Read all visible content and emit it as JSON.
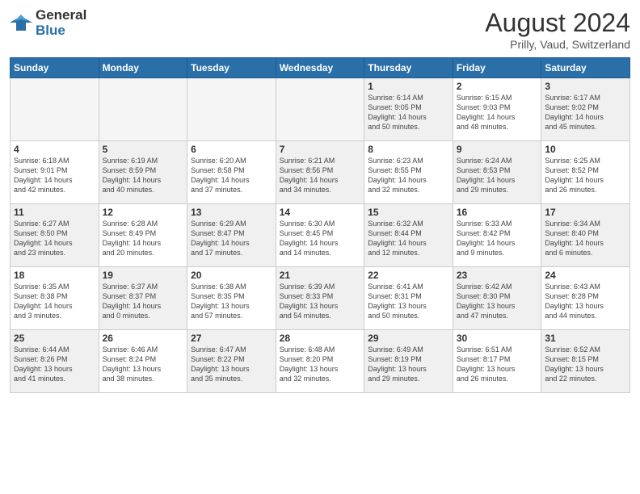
{
  "logo": {
    "line1": "General",
    "line2": "Blue"
  },
  "title": "August 2024",
  "location": "Prilly, Vaud, Switzerland",
  "days_of_week": [
    "Sunday",
    "Monday",
    "Tuesday",
    "Wednesday",
    "Thursday",
    "Friday",
    "Saturday"
  ],
  "weeks": [
    [
      {
        "num": "",
        "info": ""
      },
      {
        "num": "",
        "info": ""
      },
      {
        "num": "",
        "info": ""
      },
      {
        "num": "",
        "info": ""
      },
      {
        "num": "1",
        "info": "Sunrise: 6:14 AM\nSunset: 9:05 PM\nDaylight: 14 hours\nand 50 minutes."
      },
      {
        "num": "2",
        "info": "Sunrise: 6:15 AM\nSunset: 9:03 PM\nDaylight: 14 hours\nand 48 minutes."
      },
      {
        "num": "3",
        "info": "Sunrise: 6:17 AM\nSunset: 9:02 PM\nDaylight: 14 hours\nand 45 minutes."
      }
    ],
    [
      {
        "num": "4",
        "info": "Sunrise: 6:18 AM\nSunset: 9:01 PM\nDaylight: 14 hours\nand 42 minutes."
      },
      {
        "num": "5",
        "info": "Sunrise: 6:19 AM\nSunset: 8:59 PM\nDaylight: 14 hours\nand 40 minutes."
      },
      {
        "num": "6",
        "info": "Sunrise: 6:20 AM\nSunset: 8:58 PM\nDaylight: 14 hours\nand 37 minutes."
      },
      {
        "num": "7",
        "info": "Sunrise: 6:21 AM\nSunset: 8:56 PM\nDaylight: 14 hours\nand 34 minutes."
      },
      {
        "num": "8",
        "info": "Sunrise: 6:23 AM\nSunset: 8:55 PM\nDaylight: 14 hours\nand 32 minutes."
      },
      {
        "num": "9",
        "info": "Sunrise: 6:24 AM\nSunset: 8:53 PM\nDaylight: 14 hours\nand 29 minutes."
      },
      {
        "num": "10",
        "info": "Sunrise: 6:25 AM\nSunset: 8:52 PM\nDaylight: 14 hours\nand 26 minutes."
      }
    ],
    [
      {
        "num": "11",
        "info": "Sunrise: 6:27 AM\nSunset: 8:50 PM\nDaylight: 14 hours\nand 23 minutes."
      },
      {
        "num": "12",
        "info": "Sunrise: 6:28 AM\nSunset: 8:49 PM\nDaylight: 14 hours\nand 20 minutes."
      },
      {
        "num": "13",
        "info": "Sunrise: 6:29 AM\nSunset: 8:47 PM\nDaylight: 14 hours\nand 17 minutes."
      },
      {
        "num": "14",
        "info": "Sunrise: 6:30 AM\nSunset: 8:45 PM\nDaylight: 14 hours\nand 14 minutes."
      },
      {
        "num": "15",
        "info": "Sunrise: 6:32 AM\nSunset: 8:44 PM\nDaylight: 14 hours\nand 12 minutes."
      },
      {
        "num": "16",
        "info": "Sunrise: 6:33 AM\nSunset: 8:42 PM\nDaylight: 14 hours\nand 9 minutes."
      },
      {
        "num": "17",
        "info": "Sunrise: 6:34 AM\nSunset: 8:40 PM\nDaylight: 14 hours\nand 6 minutes."
      }
    ],
    [
      {
        "num": "18",
        "info": "Sunrise: 6:35 AM\nSunset: 8:38 PM\nDaylight: 14 hours\nand 3 minutes."
      },
      {
        "num": "19",
        "info": "Sunrise: 6:37 AM\nSunset: 8:37 PM\nDaylight: 14 hours\nand 0 minutes."
      },
      {
        "num": "20",
        "info": "Sunrise: 6:38 AM\nSunset: 8:35 PM\nDaylight: 13 hours\nand 57 minutes."
      },
      {
        "num": "21",
        "info": "Sunrise: 6:39 AM\nSunset: 8:33 PM\nDaylight: 13 hours\nand 54 minutes."
      },
      {
        "num": "22",
        "info": "Sunrise: 6:41 AM\nSunset: 8:31 PM\nDaylight: 13 hours\nand 50 minutes."
      },
      {
        "num": "23",
        "info": "Sunrise: 6:42 AM\nSunset: 8:30 PM\nDaylight: 13 hours\nand 47 minutes."
      },
      {
        "num": "24",
        "info": "Sunrise: 6:43 AM\nSunset: 8:28 PM\nDaylight: 13 hours\nand 44 minutes."
      }
    ],
    [
      {
        "num": "25",
        "info": "Sunrise: 6:44 AM\nSunset: 8:26 PM\nDaylight: 13 hours\nand 41 minutes."
      },
      {
        "num": "26",
        "info": "Sunrise: 6:46 AM\nSunset: 8:24 PM\nDaylight: 13 hours\nand 38 minutes."
      },
      {
        "num": "27",
        "info": "Sunrise: 6:47 AM\nSunset: 8:22 PM\nDaylight: 13 hours\nand 35 minutes."
      },
      {
        "num": "28",
        "info": "Sunrise: 6:48 AM\nSunset: 8:20 PM\nDaylight: 13 hours\nand 32 minutes."
      },
      {
        "num": "29",
        "info": "Sunrise: 6:49 AM\nSunset: 8:19 PM\nDaylight: 13 hours\nand 29 minutes."
      },
      {
        "num": "30",
        "info": "Sunrise: 6:51 AM\nSunset: 8:17 PM\nDaylight: 13 hours\nand 26 minutes."
      },
      {
        "num": "31",
        "info": "Sunrise: 6:52 AM\nSunset: 8:15 PM\nDaylight: 13 hours\nand 22 minutes."
      }
    ]
  ]
}
